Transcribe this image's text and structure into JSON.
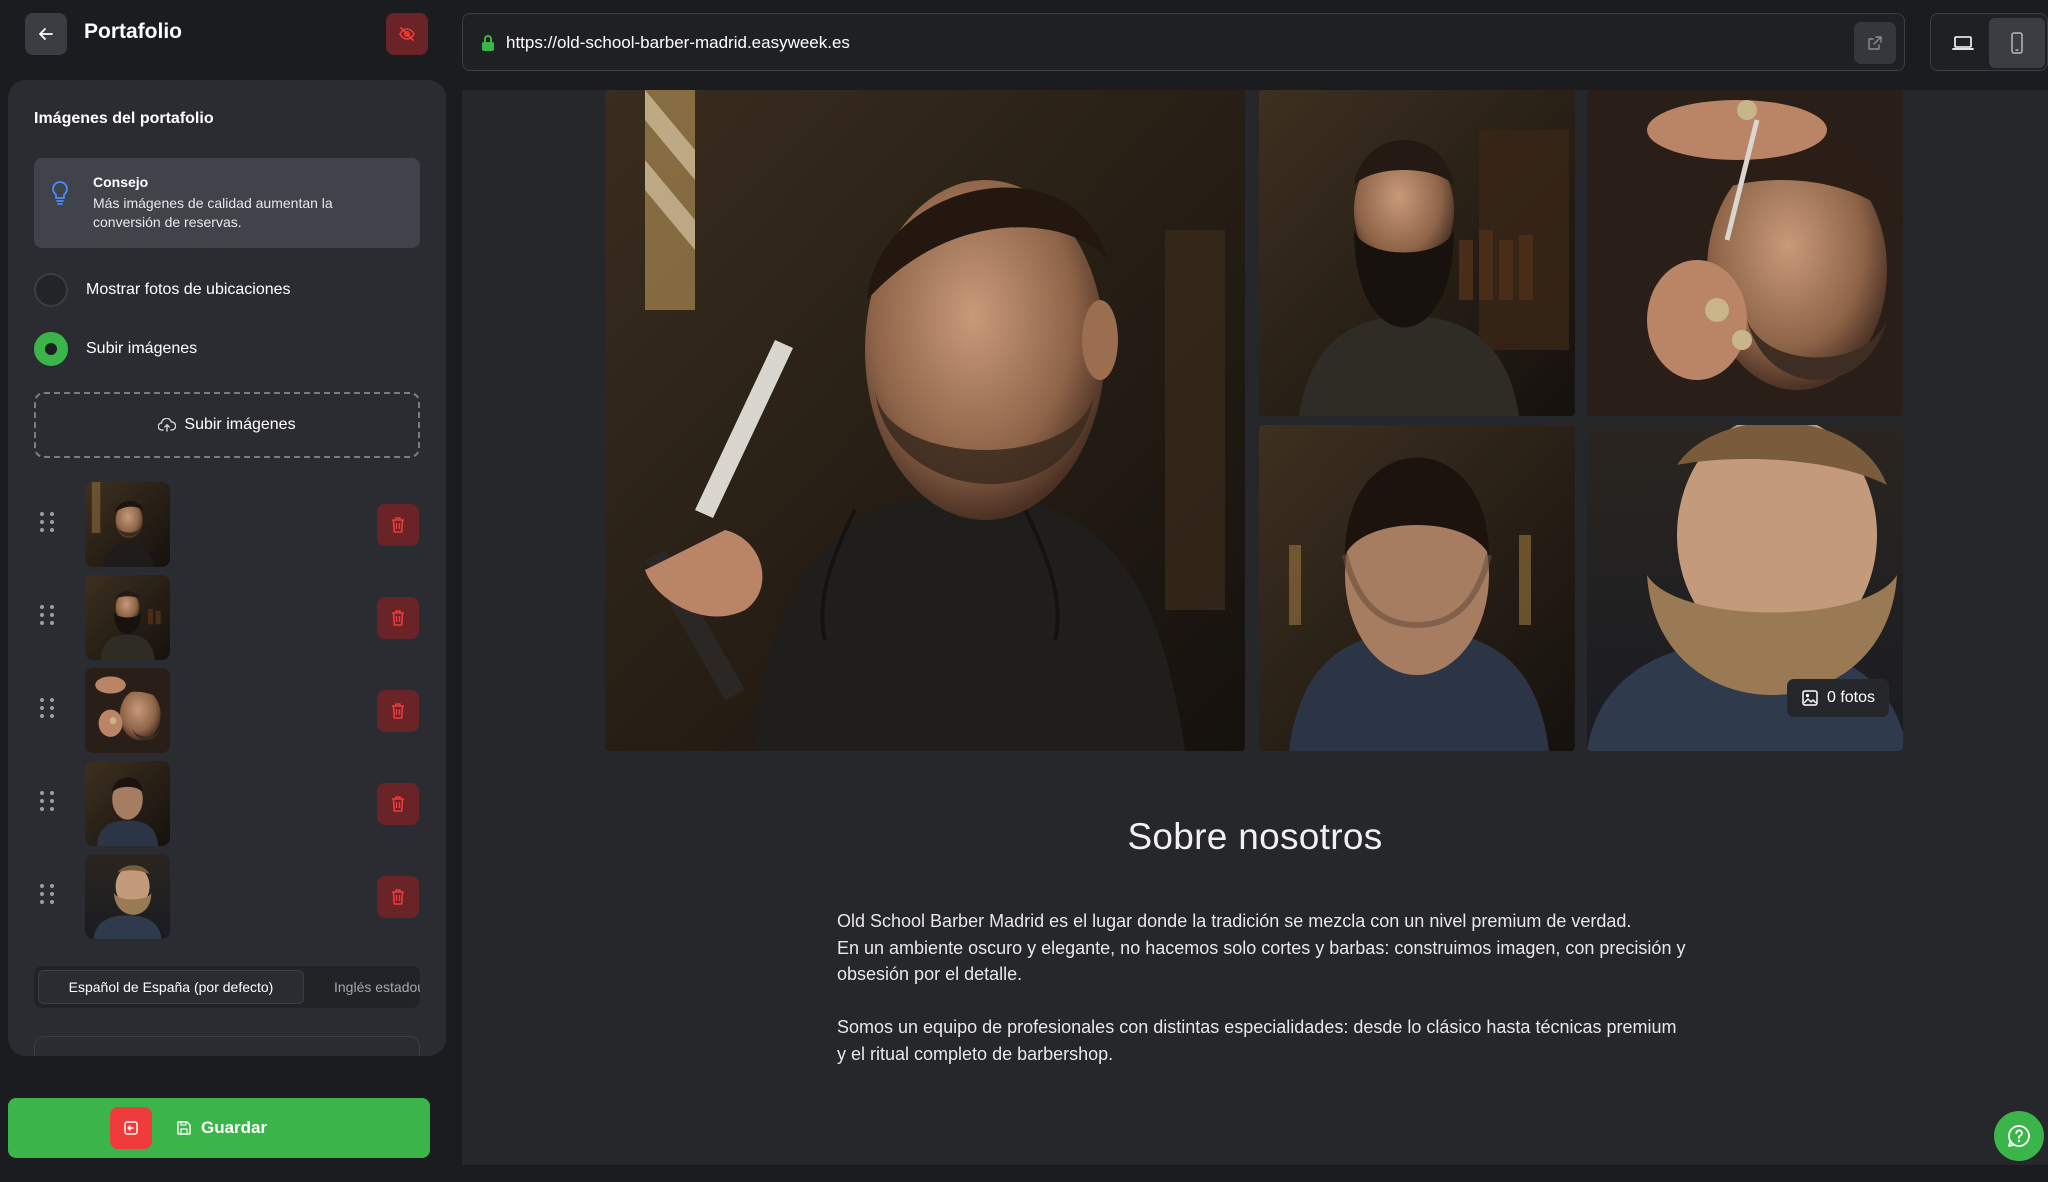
{
  "panel": {
    "title": "Portafolio",
    "heading": "Imágenes del portafolio",
    "tip": {
      "title": "Consejo",
      "text": "Más imágenes de calidad aumentan la conversión de reservas."
    },
    "options": [
      {
        "label": "Mostrar fotos de ubicaciones",
        "selected": false
      },
      {
        "label": "Subir imágenes",
        "selected": true
      }
    ],
    "upload_label": "Subir imágenes",
    "images": [
      {
        "alt": "Hombre con peinado clásico y barba corta"
      },
      {
        "alt": "Hombre con barba larga en barbería"
      },
      {
        "alt": "Barbero perfilando la barba"
      },
      {
        "alt": "Corte degradado visto desde atrás"
      },
      {
        "alt": "Barba poblada de perfil"
      }
    ],
    "languages": [
      "Español de España (por defecto)",
      "Inglés estadounidense"
    ],
    "save_label": "Guardar"
  },
  "browser": {
    "url": "https://old-school-barber-madrid.easyweek.es"
  },
  "site": {
    "photo_count": "0 fotos",
    "about_title": "Sobre nosotros",
    "about_paragraphs": [
      "Old School Barber Madrid es el lugar donde la tradición se mezcla con un nivel premium de verdad.\nEn un ambiente oscuro y elegante, no hacemos solo cortes y barbas: construimos imagen, con precisión y obsesión por el detalle.",
      "Somos un equipo de profesionales con distintas especialidades: desde lo clásico hasta técnicas premium y el ritual completo de barbershop."
    ]
  },
  "colors": {
    "accent_green": "#3bb54a",
    "danger_red": "#ef3b3b",
    "panel_bg": "#2b2c31"
  }
}
